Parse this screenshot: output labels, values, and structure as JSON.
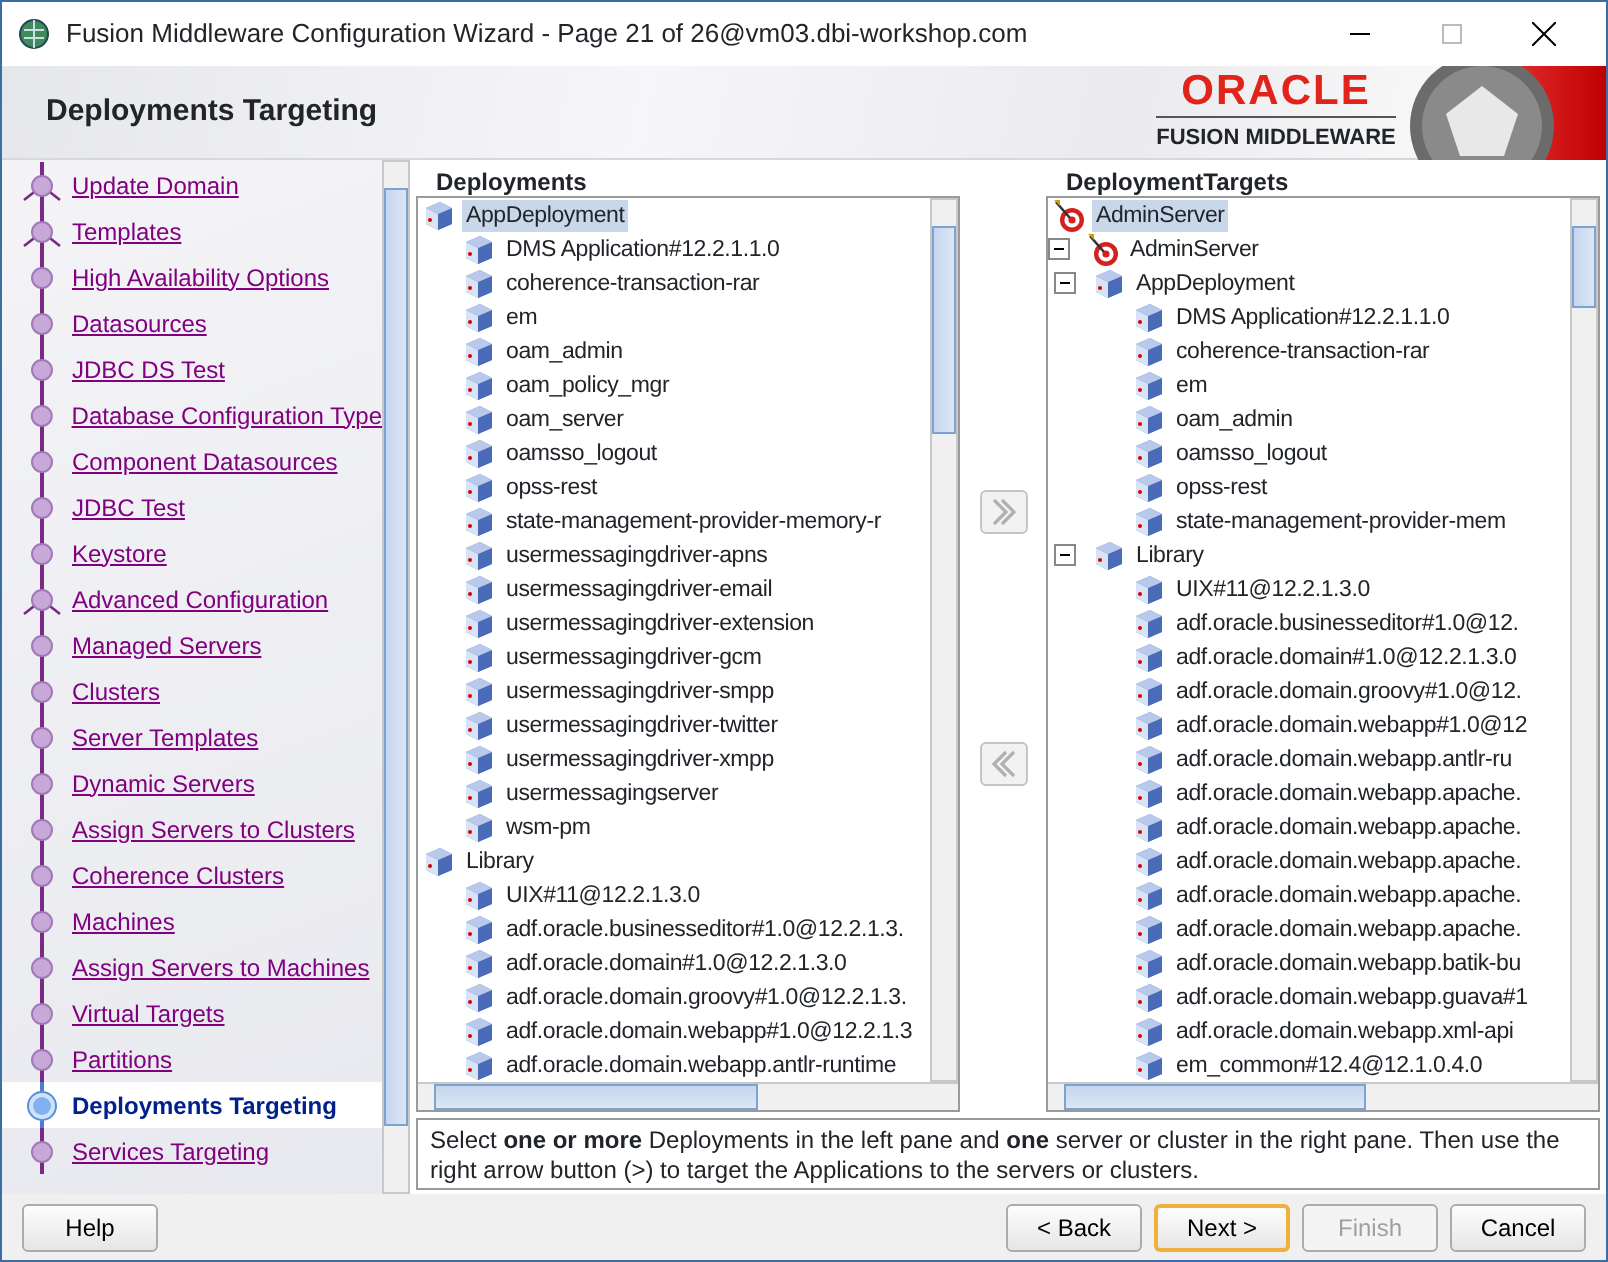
{
  "window": {
    "title": "Fusion Middleware Configuration Wizard - Page 21 of 26@vm03.dbi-workshop.com"
  },
  "header": {
    "title": "Deployments Targeting",
    "logo_brand": "ORACLE",
    "logo_product": "FUSION MIDDLEWARE"
  },
  "steps": [
    {
      "label": "Update Domain",
      "branch": true,
      "selected": false
    },
    {
      "label": "Templates",
      "branch": true,
      "selected": false
    },
    {
      "label": "High Availability Options",
      "branch": false,
      "selected": false
    },
    {
      "label": "Datasources",
      "branch": false,
      "selected": false
    },
    {
      "label": "JDBC DS Test",
      "branch": false,
      "selected": false
    },
    {
      "label": "Database Configuration Type",
      "branch": false,
      "selected": false
    },
    {
      "label": "Component Datasources",
      "branch": false,
      "selected": false
    },
    {
      "label": "JDBC Test",
      "branch": false,
      "selected": false
    },
    {
      "label": "Keystore",
      "branch": false,
      "selected": false
    },
    {
      "label": "Advanced Configuration",
      "branch": true,
      "selected": false
    },
    {
      "label": "Managed Servers",
      "branch": false,
      "selected": false
    },
    {
      "label": "Clusters",
      "branch": false,
      "selected": false
    },
    {
      "label": "Server Templates",
      "branch": false,
      "selected": false
    },
    {
      "label": "Dynamic Servers",
      "branch": false,
      "selected": false
    },
    {
      "label": "Assign Servers to Clusters",
      "branch": false,
      "selected": false
    },
    {
      "label": "Coherence Clusters",
      "branch": false,
      "selected": false
    },
    {
      "label": "Machines",
      "branch": false,
      "selected": false
    },
    {
      "label": "Assign Servers to Machines",
      "branch": false,
      "selected": false
    },
    {
      "label": "Virtual Targets",
      "branch": false,
      "selected": false
    },
    {
      "label": "Partitions",
      "branch": false,
      "selected": false
    },
    {
      "label": "Deployments Targeting",
      "branch": false,
      "selected": true
    },
    {
      "label": "Services Targeting",
      "branch": false,
      "selected": false
    }
  ],
  "deployments": {
    "title": "Deployments",
    "tree": [
      {
        "label": "AppDeployment",
        "kind": "deployment",
        "selected": true,
        "children": [
          {
            "label": "DMS Application#12.2.1.1.0",
            "kind": "deployment",
            "selected": false
          },
          {
            "label": "coherence-transaction-rar",
            "kind": "deployment",
            "selected": false
          },
          {
            "label": "em",
            "kind": "deployment",
            "selected": false
          },
          {
            "label": "oam_admin",
            "kind": "deployment",
            "selected": false
          },
          {
            "label": "oam_policy_mgr",
            "kind": "deployment",
            "selected": false
          },
          {
            "label": "oam_server",
            "kind": "deployment",
            "selected": false
          },
          {
            "label": "oamsso_logout",
            "kind": "deployment",
            "selected": false
          },
          {
            "label": "opss-rest",
            "kind": "deployment",
            "selected": false
          },
          {
            "label": "state-management-provider-memory-r",
            "kind": "deployment",
            "selected": false
          },
          {
            "label": "usermessagingdriver-apns",
            "kind": "deployment",
            "selected": false
          },
          {
            "label": "usermessagingdriver-email",
            "kind": "deployment",
            "selected": false
          },
          {
            "label": "usermessagingdriver-extension",
            "kind": "deployment",
            "selected": false
          },
          {
            "label": "usermessagingdriver-gcm",
            "kind": "deployment",
            "selected": false
          },
          {
            "label": "usermessagingdriver-smpp",
            "kind": "deployment",
            "selected": false
          },
          {
            "label": "usermessagingdriver-twitter",
            "kind": "deployment",
            "selected": false
          },
          {
            "label": "usermessagingdriver-xmpp",
            "kind": "deployment",
            "selected": false
          },
          {
            "label": "usermessagingserver",
            "kind": "deployment",
            "selected": false
          },
          {
            "label": "wsm-pm",
            "kind": "deployment",
            "selected": false
          }
        ]
      },
      {
        "label": "Library",
        "kind": "deployment",
        "selected": false,
        "children": [
          {
            "label": "UIX#11@12.2.1.3.0",
            "kind": "deployment",
            "selected": false
          },
          {
            "label": "adf.oracle.businesseditor#1.0@12.2.1.3.",
            "kind": "deployment",
            "selected": false
          },
          {
            "label": "adf.oracle.domain#1.0@12.2.1.3.0",
            "kind": "deployment",
            "selected": false
          },
          {
            "label": "adf.oracle.domain.groovy#1.0@12.2.1.3.",
            "kind": "deployment",
            "selected": false
          },
          {
            "label": "adf.oracle.domain.webapp#1.0@12.2.1.3",
            "kind": "deployment",
            "selected": false
          },
          {
            "label": "adf.oracle.domain.webapp.antlr-runtime",
            "kind": "deployment",
            "selected": false
          }
        ]
      }
    ]
  },
  "targets": {
    "title": "DeploymentTargets",
    "tree": [
      {
        "label": "AdminServer",
        "kind": "server",
        "selected": true
      },
      {
        "label": "AdminServer",
        "kind": "server",
        "selected": false,
        "expanded": true,
        "children": [
          {
            "label": "AppDeployment",
            "kind": "deployment",
            "selected": false,
            "expanded": true,
            "children": [
              {
                "label": "DMS Application#12.2.1.1.0",
                "kind": "deployment",
                "selected": false
              },
              {
                "label": "coherence-transaction-rar",
                "kind": "deployment",
                "selected": false
              },
              {
                "label": "em",
                "kind": "deployment",
                "selected": false
              },
              {
                "label": "oam_admin",
                "kind": "deployment",
                "selected": false
              },
              {
                "label": "oamsso_logout",
                "kind": "deployment",
                "selected": false
              },
              {
                "label": "opss-rest",
                "kind": "deployment",
                "selected": false
              },
              {
                "label": "state-management-provider-mem",
                "kind": "deployment",
                "selected": false
              }
            ]
          },
          {
            "label": "Library",
            "kind": "deployment",
            "selected": false,
            "expanded": true,
            "children": [
              {
                "label": "UIX#11@12.2.1.3.0",
                "kind": "deployment",
                "selected": false
              },
              {
                "label": "adf.oracle.businesseditor#1.0@12.",
                "kind": "deployment",
                "selected": false
              },
              {
                "label": "adf.oracle.domain#1.0@12.2.1.3.0",
                "kind": "deployment",
                "selected": false
              },
              {
                "label": "adf.oracle.domain.groovy#1.0@12.",
                "kind": "deployment",
                "selected": false
              },
              {
                "label": "adf.oracle.domain.webapp#1.0@12",
                "kind": "deployment",
                "selected": false
              },
              {
                "label": "adf.oracle.domain.webapp.antlr-ru",
                "kind": "deployment",
                "selected": false
              },
              {
                "label": "adf.oracle.domain.webapp.apache.",
                "kind": "deployment",
                "selected": false
              },
              {
                "label": "adf.oracle.domain.webapp.apache.",
                "kind": "deployment",
                "selected": false
              },
              {
                "label": "adf.oracle.domain.webapp.apache.",
                "kind": "deployment",
                "selected": false
              },
              {
                "label": "adf.oracle.domain.webapp.apache.",
                "kind": "deployment",
                "selected": false
              },
              {
                "label": "adf.oracle.domain.webapp.apache.",
                "kind": "deployment",
                "selected": false
              },
              {
                "label": "adf.oracle.domain.webapp.batik-bu",
                "kind": "deployment",
                "selected": false
              },
              {
                "label": "adf.oracle.domain.webapp.guava#1",
                "kind": "deployment",
                "selected": false
              },
              {
                "label": "adf.oracle.domain.webapp.xml-api",
                "kind": "deployment",
                "selected": false
              },
              {
                "label": "em_common#12.4@12.1.0.4.0",
                "kind": "deployment",
                "selected": false
              }
            ]
          }
        ]
      }
    ]
  },
  "move_buttons": [
    {
      "kind": "right",
      "disabled": true
    },
    {
      "kind": "left",
      "disabled": true
    }
  ],
  "description": "Select **one or more** Deployments in the left pane and **one** server or cluster in the right pane. Then use the right arrow button (>) to target the Applications to the servers or clusters.",
  "buttons": [
    {
      "label": "Help",
      "kind": "help",
      "disabled": false,
      "default": false
    },
    {
      "label": "< Back",
      "kind": "nav",
      "disabled": false,
      "default": false
    },
    {
      "label": "Next >",
      "kind": "nav",
      "disabled": false,
      "default": true
    },
    {
      "label": "Finish",
      "kind": "nav",
      "disabled": true,
      "default": false
    },
    {
      "label": "Cancel",
      "kind": "nav",
      "disabled": false,
      "default": false
    }
  ]
}
